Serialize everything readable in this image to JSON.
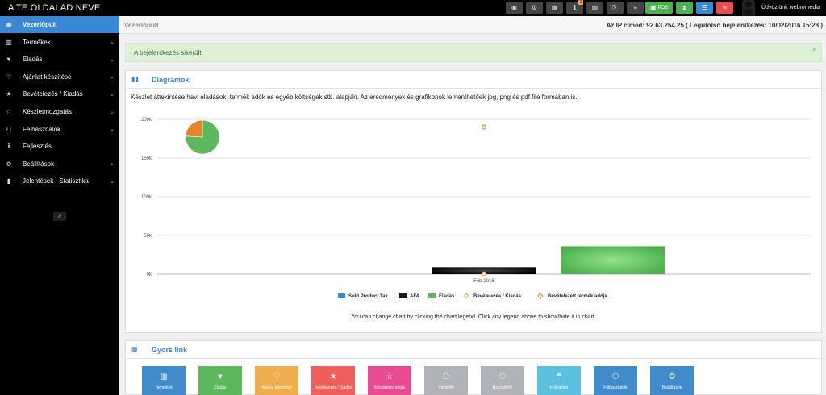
{
  "header": {
    "brand": "A TE OLDALAD NEVE",
    "buttons": [
      {
        "icon": "dashboard-icon",
        "glyph": "◉"
      },
      {
        "icon": "cogs-icon",
        "glyph": "⚙"
      },
      {
        "icon": "calculator-icon",
        "glyph": "▦"
      },
      {
        "icon": "info-icon",
        "glyph": "ℹ",
        "badge": "1"
      },
      {
        "icon": "calendar-icon",
        "glyph": "▤"
      },
      {
        "icon": "export-icon",
        "glyph": "⎘"
      },
      {
        "icon": "flag-hu-icon",
        "glyph": "≡"
      },
      {
        "icon": "pos-icon",
        "glyph": "▣",
        "label": "POS"
      },
      {
        "icon": "hourglass-icon",
        "glyph": "⧗"
      },
      {
        "icon": "list-icon",
        "glyph": "☰"
      },
      {
        "icon": "eraser-icon",
        "glyph": "✎"
      }
    ],
    "welcome": "Üdvözlünk webromedia"
  },
  "sidebar": {
    "items": [
      {
        "label": "Vezérlőpult",
        "icon": "dashboard-icon",
        "glyph": "◉",
        "active": true,
        "chevron": false
      },
      {
        "label": "Termékek",
        "icon": "barcode-icon",
        "glyph": "▥",
        "chevron": true
      },
      {
        "label": "Eladás",
        "icon": "heart-icon",
        "glyph": "♥",
        "chevron": true
      },
      {
        "label": "Ajánlat készítése",
        "icon": "heart-outline-icon",
        "glyph": "♡",
        "chevron": true
      },
      {
        "label": "Bevételezés / Kiadás",
        "icon": "star-icon",
        "glyph": "★",
        "chevron": true
      },
      {
        "label": "Készletmozgatás",
        "icon": "star-outline-icon",
        "glyph": "☆",
        "chevron": true
      },
      {
        "label": "Felhasználók",
        "icon": "users-icon",
        "glyph": "⚇",
        "chevron": true
      },
      {
        "label": "Fejlesztés",
        "icon": "info-icon",
        "glyph": "ℹ",
        "chevron": false
      },
      {
        "label": "Beállítások",
        "icon": "cog-icon",
        "glyph": "⚙",
        "chevron": true
      },
      {
        "label": "Jelentések - Statisztika",
        "icon": "bar-chart-icon",
        "glyph": "▮",
        "chevron": true
      }
    ],
    "collapse_glyph": "«"
  },
  "breadcrumb": "Vezérlőpult",
  "ip_info": "Az IP címed: 92.63.254.25 ( Legutolsó bejelentkezés: 10/02/2016 15:28 )",
  "alert": {
    "text": "A bejelentkezés sikerült!",
    "close": "×"
  },
  "diagram": {
    "title": "Diagramok",
    "description": "Készlet áttekintése havi eladások, termék adók és egyéb költségek stb. alapján. Az eredmények és grafikonok lementhetőek jpg, png és pdf file formában is.",
    "hint": "You can change chart by clicking the chart legend. Click any legend above to show/hide it in chart."
  },
  "chart_data": {
    "type": "bar",
    "categories": [
      "Feb-2016"
    ],
    "ylim": [
      0,
      200000
    ],
    "yticks": [
      0,
      50000,
      100000,
      150000,
      200000
    ],
    "ytick_labels": [
      "0k",
      "50k",
      "100k",
      "150k",
      "200k"
    ],
    "series": [
      {
        "name": "Sold Product Tax",
        "type": "bar",
        "color": "#3a87d6",
        "values": [
          0
        ]
      },
      {
        "name": "ÁFA",
        "type": "bar",
        "color": "#1a1a1a",
        "values": [
          9000
        ]
      },
      {
        "name": "Eladás",
        "type": "bar",
        "color": "#5cb85c",
        "values": [
          36000
        ]
      },
      {
        "name": "Bevételezés / Kiadás",
        "type": "scatter",
        "marker": "circle",
        "color": "#e8832a",
        "values": [
          190000
        ]
      },
      {
        "name": "Bevételezett termék adója",
        "type": "scatter",
        "marker": "diamond",
        "color": "#e8832a",
        "values": [
          0
        ]
      }
    ],
    "pie": {
      "slices": [
        {
          "share": 0.76,
          "color": "#5cb85c"
        },
        {
          "share": 0.24,
          "color": "#e8832a"
        }
      ]
    },
    "grid": true,
    "legend_position": "bottom"
  },
  "quick_links": {
    "title": "Gyors link",
    "items": [
      {
        "label": "Termékek",
        "icon": "barcode-icon",
        "glyph": "▥",
        "color": "#428bca"
      },
      {
        "label": "Eladás",
        "icon": "heart-icon",
        "glyph": "♥",
        "color": "#5cb85c"
      },
      {
        "label": "Ajánlat készítése",
        "icon": "heart-outline-icon",
        "glyph": "♡",
        "color": "#f0ad4e"
      },
      {
        "label": "Bevételezés / Kiadás",
        "icon": "star-icon",
        "glyph": "★",
        "color": "#ee5f5b"
      },
      {
        "label": "Készletmozgatás",
        "icon": "star-outline-icon",
        "glyph": "☆",
        "color": "#e64c8f"
      },
      {
        "label": "Vásárlók",
        "icon": "users-icon",
        "glyph": "⚇",
        "color": "#b0b3b8"
      },
      {
        "label": "Beszállítók",
        "icon": "users-icon",
        "glyph": "⚇",
        "color": "#b0b3b8"
      },
      {
        "label": "Fejlesztés",
        "icon": "comments-icon",
        "glyph": "❝",
        "color": "#5bc0de"
      },
      {
        "label": "Felhasználók",
        "icon": "users-icon",
        "glyph": "⚇",
        "color": "#428bca"
      },
      {
        "label": "Beállítások",
        "icon": "cogs-icon",
        "glyph": "⚙",
        "color": "#428bca"
      }
    ]
  }
}
